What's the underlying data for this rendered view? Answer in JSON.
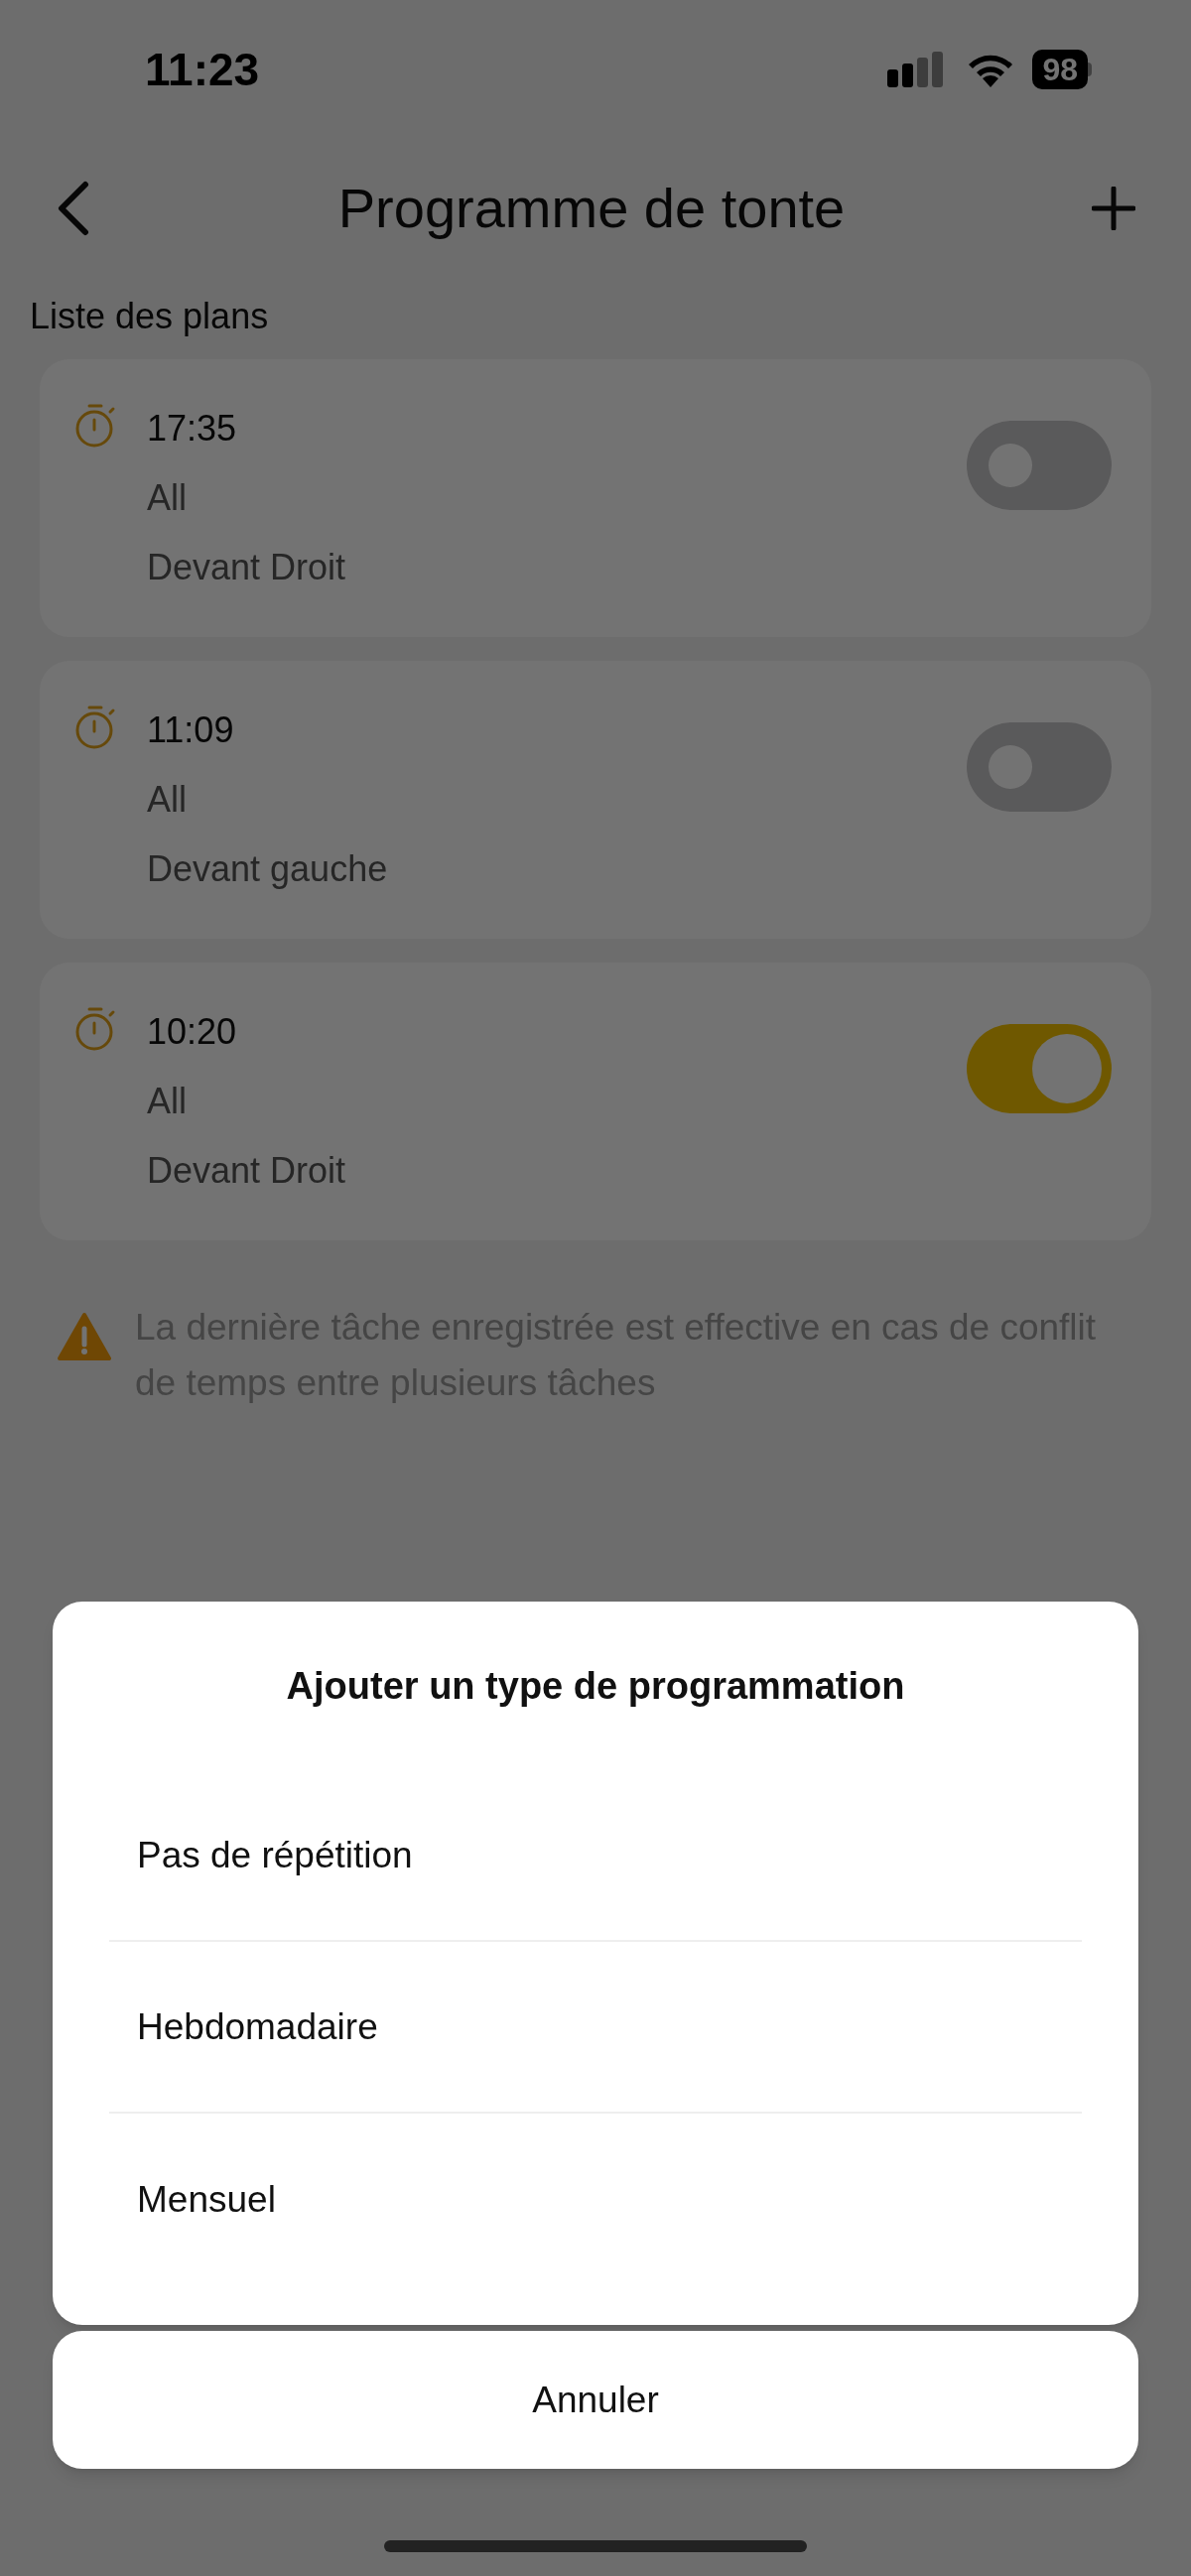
{
  "status_bar": {
    "time": "11:23",
    "battery": "98"
  },
  "header": {
    "title": "Programme de tonte"
  },
  "section_title": "Liste des plans",
  "plans": [
    {
      "time": "17:35",
      "repeat": "All",
      "zone": "Devant Droit",
      "on": false
    },
    {
      "time": "11:09",
      "repeat": "All",
      "zone": "Devant gauche",
      "on": false
    },
    {
      "time": "10:20",
      "repeat": "All",
      "zone": "Devant Droit",
      "on": true
    }
  ],
  "warning": "La dernière tâche enregistrée est effective en cas de conflit de temps entre plusieurs tâches",
  "sheet": {
    "title": "Ajouter un type de programmation",
    "options": [
      "Pas de répétition",
      "Hebdomadaire",
      "Mensuel"
    ],
    "cancel": "Annuler"
  }
}
